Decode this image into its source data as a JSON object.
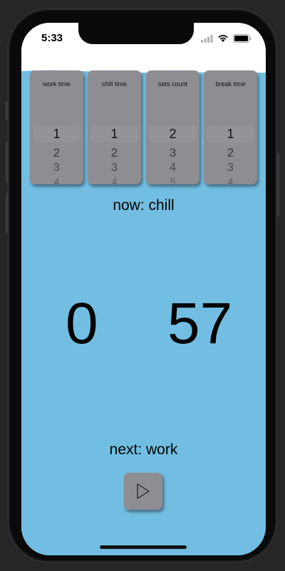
{
  "status_bar": {
    "time": "5:33"
  },
  "pickers": [
    {
      "label": "work time",
      "selected": "1",
      "next": [
        "2",
        "3",
        "4"
      ]
    },
    {
      "label": "chill time",
      "selected": "1",
      "next": [
        "2",
        "3",
        "4"
      ]
    },
    {
      "label": "sets count",
      "selected": "2",
      "next": [
        "3",
        "4",
        "5"
      ]
    },
    {
      "label": "break time",
      "selected": "1",
      "next": [
        "2",
        "3",
        "4"
      ]
    }
  ],
  "timer": {
    "now_label": "now: chill",
    "minutes": "0",
    "seconds": "57",
    "next_label": "next: work"
  },
  "colors": {
    "water": "#72bee2",
    "picker_bg": "#8e8d92"
  },
  "icons": {
    "play": "play-icon",
    "wifi": "wifi-icon",
    "battery": "battery-icon",
    "cellular": "cellular-icon"
  }
}
